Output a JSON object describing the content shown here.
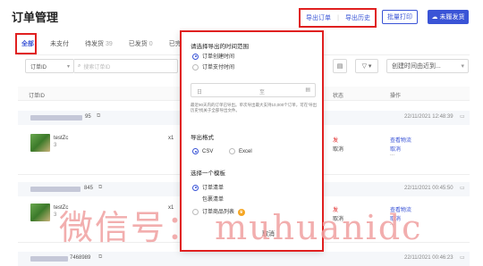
{
  "page": {
    "title": "订单管理"
  },
  "header": {
    "export_label": "导出订单",
    "history_label": "导出历史",
    "bulk_print_label": "批量打印",
    "unpublished_label": "未履发货",
    "divider": "|"
  },
  "tabs": [
    {
      "label": "全部",
      "count": ""
    },
    {
      "label": "未支付",
      "count": ""
    },
    {
      "label": "待发货",
      "count": "39"
    },
    {
      "label": "已发货",
      "count": "0"
    },
    {
      "label": "已完成",
      "count": ""
    }
  ],
  "filters": {
    "field_select": "订单ID",
    "search_placeholder": "搜索订单ID",
    "sort_select": "创建时间由近到..."
  },
  "table": {
    "col_order_id": "订单ID",
    "col_status": "状态",
    "col_action": "操作"
  },
  "orders": [
    {
      "id_suffix": "95",
      "time": "22/11/2021 12:48:39",
      "product": "testZc",
      "qty_badge": "3",
      "qty": "x1",
      "status": "发",
      "status2": "取消",
      "action1": "查看物流",
      "action2": "取消",
      "more": "..."
    },
    {
      "id_suffix": "845",
      "time": "22/11/2021 00:45:50",
      "product": "testZc",
      "qty_badge": "3",
      "qty": "x1",
      "status": "发",
      "status2": "取消",
      "action1": "查看物流",
      "action2": "取消",
      "more": "..."
    },
    {
      "id_suffix": "7468989",
      "time": "22/11/2021 00:46:23",
      "product": "",
      "qty_badge": "",
      "qty": "",
      "status": "",
      "status2": "",
      "action1": "",
      "action2": "",
      "more": ""
    }
  ],
  "popup": {
    "range_title": "请选择导出的时间范围",
    "opt_created": "订单创建时间",
    "opt_paid": "订单支付时间",
    "date_start": "日",
    "date_sep": "至",
    "note": "最近90天内的订单已导出。单次导出最大支持10,000个订单，可在'导出历史'找关于全部导出文件。",
    "format_title": "导出格式",
    "fmt_csv": "CSV",
    "fmt_excel": "Excel",
    "template_title": "选择一个模板",
    "tpl_order": "订单清单",
    "tpl_package": "包裹清单",
    "tpl_product": "订单商品列表",
    "confirm_label": "取消"
  },
  "watermark": "微信号： muhuanidc",
  "colors": {
    "accent": "#3a54d6",
    "highlight": "#e02020"
  }
}
